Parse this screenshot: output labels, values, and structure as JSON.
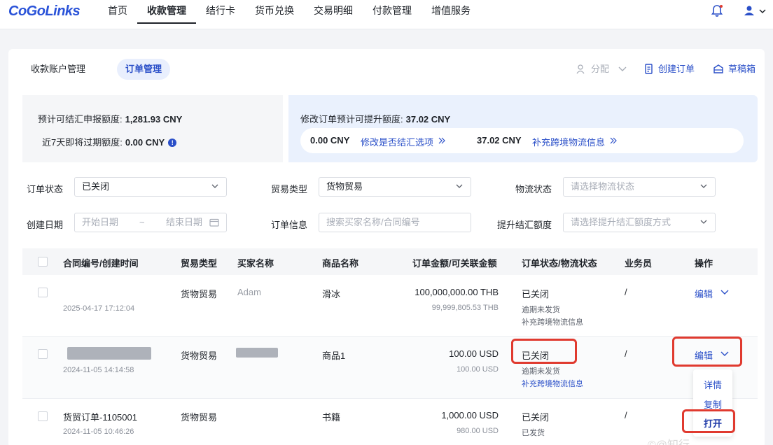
{
  "brand": "CoGoLinks",
  "nav": [
    "首页",
    "收款管理",
    "结行卡",
    "货币兑换",
    "交易明细",
    "付款管理",
    "增值服务"
  ],
  "nav_active": 1,
  "subtabs": {
    "account": "收款账户管理",
    "orders": "订单管理"
  },
  "toolbar": {
    "assign": "分配",
    "create": "创建订单",
    "draft": "草稿箱"
  },
  "summary": {
    "declarable_label": "预计可结汇申报额度:",
    "declarable_value": "1,281.93 CNY",
    "expiring_label": "近7天即将过期额度:",
    "expiring_value": "0.00 CNY",
    "raise_label": "修改订单预计可提升额度:",
    "raise_value": "37.02 CNY",
    "item1_value": "0.00 CNY",
    "item1_link": "修改是否结汇选项",
    "item2_value": "37.02 CNY",
    "item2_link": "补充跨境物流信息"
  },
  "filters": {
    "order_status_label": "订单状态",
    "order_status_value": "已关闭",
    "trade_type_label": "贸易类型",
    "trade_type_value": "货物贸易",
    "logistics_label": "物流状态",
    "logistics_placeholder": "请选择物流状态",
    "date_label": "创建日期",
    "date_start": "开始日期",
    "date_sep": "~",
    "date_end": "结束日期",
    "order_info_label": "订单信息",
    "order_info_placeholder": "搜索买家名称/合同编号",
    "raise_label": "提升结汇额度",
    "raise_placeholder": "请选择提升结汇额度方式"
  },
  "table": {
    "headers": [
      "合同编号/创建时间",
      "贸易类型",
      "买家名称",
      "商品名称",
      "订单金额/可关联金额",
      "订单状态/物流状态",
      "业务员",
      "操作"
    ],
    "rows": [
      {
        "contract": "",
        "time": "2025-04-17 17:12:04",
        "trade": "货物贸易",
        "buyer": "Adam",
        "product": "滑冰",
        "amount": "100,000,000.00 THB",
        "linkable": "99,999,805.53 THB",
        "status": "已关闭",
        "logistics": "逾期未发货",
        "logistics_link": "补充跨境物流信息",
        "sales": "/",
        "action": "编辑"
      },
      {
        "contract": "",
        "time": "2024-11-05 14:14:58",
        "trade": "货物贸易",
        "buyer": "",
        "product": "商品1",
        "amount": "100.00 USD",
        "linkable": "100.00 USD",
        "status": "已关闭",
        "logistics": "逾期未发货",
        "logistics_link": "补充跨境物流信息",
        "sales": "/",
        "action": "编辑"
      },
      {
        "contract": "货贸订单-1105001",
        "time": "2024-11-05 10:46:26",
        "trade": "货物贸易",
        "buyer": "",
        "product": "书籍",
        "amount": "1,000.00 USD",
        "linkable": "980.00 USD",
        "status": "已关闭",
        "logistics": "已发货",
        "logistics_link": "",
        "sales": "/",
        "action": ""
      }
    ]
  },
  "dropdown": [
    "详情",
    "复制",
    "打开"
  ],
  "watermark": "©@知行",
  "colors": {
    "accent": "#2a4fc8",
    "highlight": "#e03a2f"
  }
}
